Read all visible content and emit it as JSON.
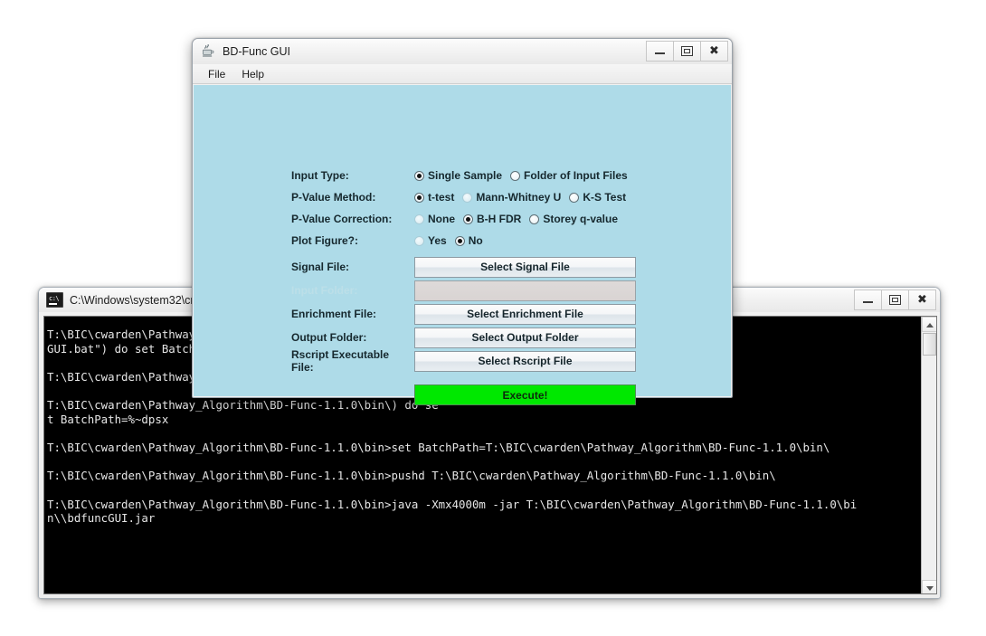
{
  "console_window": {
    "title": "C:\\Windows\\system32\\cm",
    "icon": "cmd-icon",
    "controls": {
      "minimize": "minimize",
      "maximize": "maximize",
      "close": "close"
    },
    "text": "T:\\BIC\\cwarden\\Pathway_Algorithm\\BD-Func-1.1.0\\bin\\bdfunc\nGUI.bat\") do set BatchPath=%~dpsx\n\nT:\\BIC\\cwarden\\Pathway_Algorithm\\BD-Func-1.1.0\\bin\\\n\nT:\\BIC\\cwarden\\Pathway_Algorithm\\BD-Func-1.1.0\\bin\\) do se\nt BatchPath=%~dpsx\n\nT:\\BIC\\cwarden\\Pathway_Algorithm\\BD-Func-1.1.0\\bin>set BatchPath=T:\\BIC\\cwarden\\Pathway_Algorithm\\BD-Func-1.1.0\\bin\\\n\nT:\\BIC\\cwarden\\Pathway_Algorithm\\BD-Func-1.1.0\\bin>pushd T:\\BIC\\cwarden\\Pathway_Algorithm\\BD-Func-1.1.0\\bin\\\n\nT:\\BIC\\cwarden\\Pathway_Algorithm\\BD-Func-1.1.0\\bin>java -Xmx4000m -jar T:\\BIC\\cwarden\\Pathway_Algorithm\\BD-Func-1.1.0\\bi\nn\\\\bdfuncGUI.jar"
  },
  "gui_window": {
    "title": "BD-Func GUI",
    "icon": "java-icon",
    "controls": {
      "minimize": "minimize",
      "maximize": "maximize",
      "close": "close"
    },
    "menubar": [
      {
        "label": "File"
      },
      {
        "label": "Help"
      }
    ],
    "panel_color": "#aedbe8",
    "form": {
      "input_type": {
        "label": "Input Type:",
        "options": [
          {
            "label": "Single Sample",
            "checked": true
          },
          {
            "label": "Folder of Input Files",
            "checked": false
          }
        ]
      },
      "pvalue_method": {
        "label": "P-Value Method:",
        "options": [
          {
            "label": "t-test",
            "checked": true
          },
          {
            "label": "Mann-Whitney U",
            "checked": false,
            "faded": true
          },
          {
            "label": "K-S Test",
            "checked": false
          }
        ]
      },
      "pvalue_correction": {
        "label": "P-Value Correction:",
        "options": [
          {
            "label": "None",
            "checked": false,
            "faded": true
          },
          {
            "label": "B-H FDR",
            "checked": true
          },
          {
            "label": "Storey q-value",
            "checked": false
          }
        ]
      },
      "plot_figure": {
        "label": "Plot Figure?:",
        "options": [
          {
            "label": "Yes",
            "checked": false,
            "faded": true
          },
          {
            "label": "No",
            "checked": true
          }
        ]
      },
      "file_rows": [
        {
          "label": "Signal File:",
          "button": "Select Signal File",
          "disabled": false
        },
        {
          "label": "Input Folder:",
          "button": "",
          "disabled": true
        },
        {
          "label": "Enrichment File:",
          "button": "Select Enrichment File",
          "disabled": false
        },
        {
          "label": "Output Folder:",
          "button": "Select Output Folder",
          "disabled": false
        },
        {
          "label": "Rscript Executable File:",
          "button": "Select Rscript File",
          "disabled": false
        }
      ],
      "execute": {
        "label": "Execute!",
        "color": "#00e800"
      }
    }
  }
}
